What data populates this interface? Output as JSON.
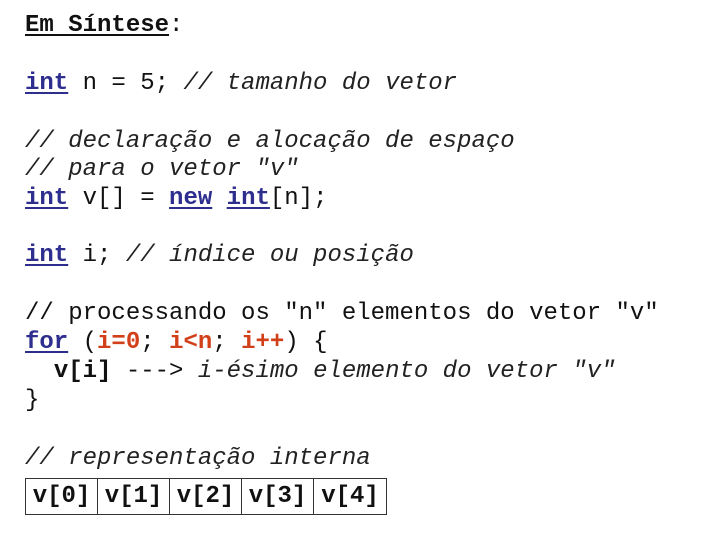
{
  "title": {
    "text": "Em Síntese",
    "suffix": ":"
  },
  "lines": {
    "l1": {
      "kw": "int",
      "code": " n = 5; ",
      "comment": "// tamanho do vetor"
    },
    "l2": {
      "comment": "// declaração e alocação de espaço"
    },
    "l3": {
      "comment": "// para o vetor \"v\""
    },
    "l4": {
      "kw1": "int",
      "code1": " v[] = ",
      "kw2": "new",
      "sp": " ",
      "kw3": "int",
      "code2": "[n];"
    },
    "l5": {
      "kw": "int",
      "code": " i; ",
      "comment": "// índice ou posição"
    },
    "l6": {
      "text": "// processando os \"n\" elementos do vetor \"v\""
    },
    "l7": {
      "kw": "for",
      "p1": " (",
      "r1": "i=0",
      "s1": "; ",
      "r2": "i<n",
      "s2": "; ",
      "r3": "i++",
      "p2": ") {"
    },
    "l8": {
      "indent": "  ",
      "expr": "v[i]",
      "arrow": " ---> ",
      "comment": "i-ésimo elemento do vetor \"v\""
    },
    "l9": {
      "text": "}"
    },
    "l10": {
      "comment": "// representação interna"
    }
  },
  "vector_cells": [
    "v[0]",
    "v[1]",
    "v[2]",
    "v[3]",
    "v[4]"
  ],
  "colors": {
    "keyword": "#2e2e8f",
    "highlight": "#d2401a"
  }
}
